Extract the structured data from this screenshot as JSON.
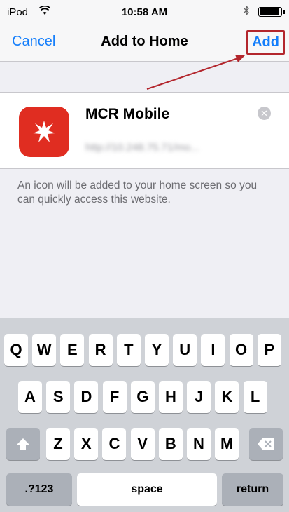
{
  "status_bar": {
    "carrier": "iPod",
    "time": "10:58 AM",
    "battery_level": 0.95
  },
  "nav_bar": {
    "cancel_label": "Cancel",
    "title": "Add to Home",
    "add_label": "Add"
  },
  "bookmark": {
    "name_value": "MCR Mobile",
    "url": "http://10.248.75.71/mo..."
  },
  "hint_text": "An icon will be added to your home screen so you can quickly access this website.",
  "keyboard": {
    "row1": [
      "Q",
      "W",
      "E",
      "R",
      "T",
      "Y",
      "U",
      "I",
      "O",
      "P"
    ],
    "row2": [
      "A",
      "S",
      "D",
      "F",
      "G",
      "H",
      "J",
      "K",
      "L"
    ],
    "row3": [
      "Z",
      "X",
      "C",
      "V",
      "B",
      "N",
      "M"
    ],
    "numbers_label": ".?123",
    "space_label": "space",
    "return_label": "return"
  },
  "colors": {
    "accent": "#147efb",
    "highlight_box": "#b3262d",
    "app_icon_bg": "#e02d21"
  },
  "icons": [
    "wifi-icon",
    "bluetooth-icon",
    "battery-icon",
    "app-icon",
    "clear-icon",
    "shift-icon",
    "backspace-icon",
    "arrow-annotation"
  ]
}
